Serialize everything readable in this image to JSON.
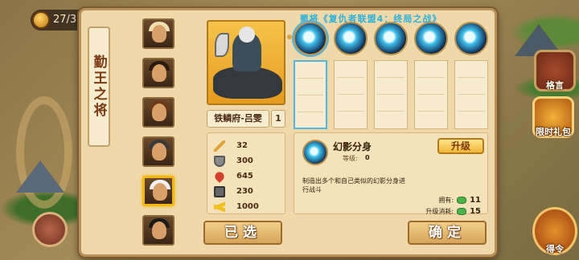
{
  "title": "蜀将《复仇者联盟4：终局之战》",
  "top_counter": {
    "value": "27/34"
  },
  "side_buttons": {
    "book_label": "格言",
    "gift_label": "限时礼包",
    "order_label": "得令"
  },
  "banner": {
    "title": "勤王之将"
  },
  "portraits": [
    {
      "name": "portrait-1",
      "helm": "#f0e0b0"
    },
    {
      "name": "portrait-2",
      "helm": "#2a1a10"
    },
    {
      "name": "portrait-3",
      "helm": "#6a3a1a"
    },
    {
      "name": "portrait-4",
      "helm": "#3a3a3a"
    },
    {
      "name": "portrait-5",
      "helm": "#f2f2f2",
      "selected": true
    },
    {
      "name": "portrait-6",
      "helm": "#1a1a1a"
    }
  ],
  "hero": {
    "name": "铁鳞府-吕雯",
    "level": "1"
  },
  "stats": [
    {
      "icon": "sword-icon",
      "value": "32"
    },
    {
      "icon": "shield-icon",
      "value": "300"
    },
    {
      "icon": "heart-icon",
      "value": "645"
    },
    {
      "icon": "armor-icon",
      "value": "230"
    },
    {
      "icon": "bolt-icon",
      "value": "1000"
    }
  ],
  "skills": [
    {
      "icon": "skill-tornado-icon",
      "selected": true
    },
    {
      "icon": "skill-swirl-icon"
    },
    {
      "icon": "skill-wave-icon"
    },
    {
      "icon": "skill-wind-icon"
    },
    {
      "icon": "skill-spark-icon"
    }
  ],
  "detail": {
    "name": "幻影分身",
    "level_label": "等级:",
    "level_value": "0",
    "upgrade_label": "升级",
    "description": "制造出多个和自己类似的幻影分身进行战斗",
    "own_label": "拥有:",
    "own_value": "11",
    "cost_label": "升级消耗:",
    "cost_value": "15"
  },
  "buttons": {
    "selected_label": "已选",
    "confirm_label": "确定"
  },
  "colors": {
    "panel": "#efd9aa",
    "accent_gold": "#f4b515",
    "highlight_blue": "#52b6e0",
    "gem_green": "#4bb54a"
  }
}
